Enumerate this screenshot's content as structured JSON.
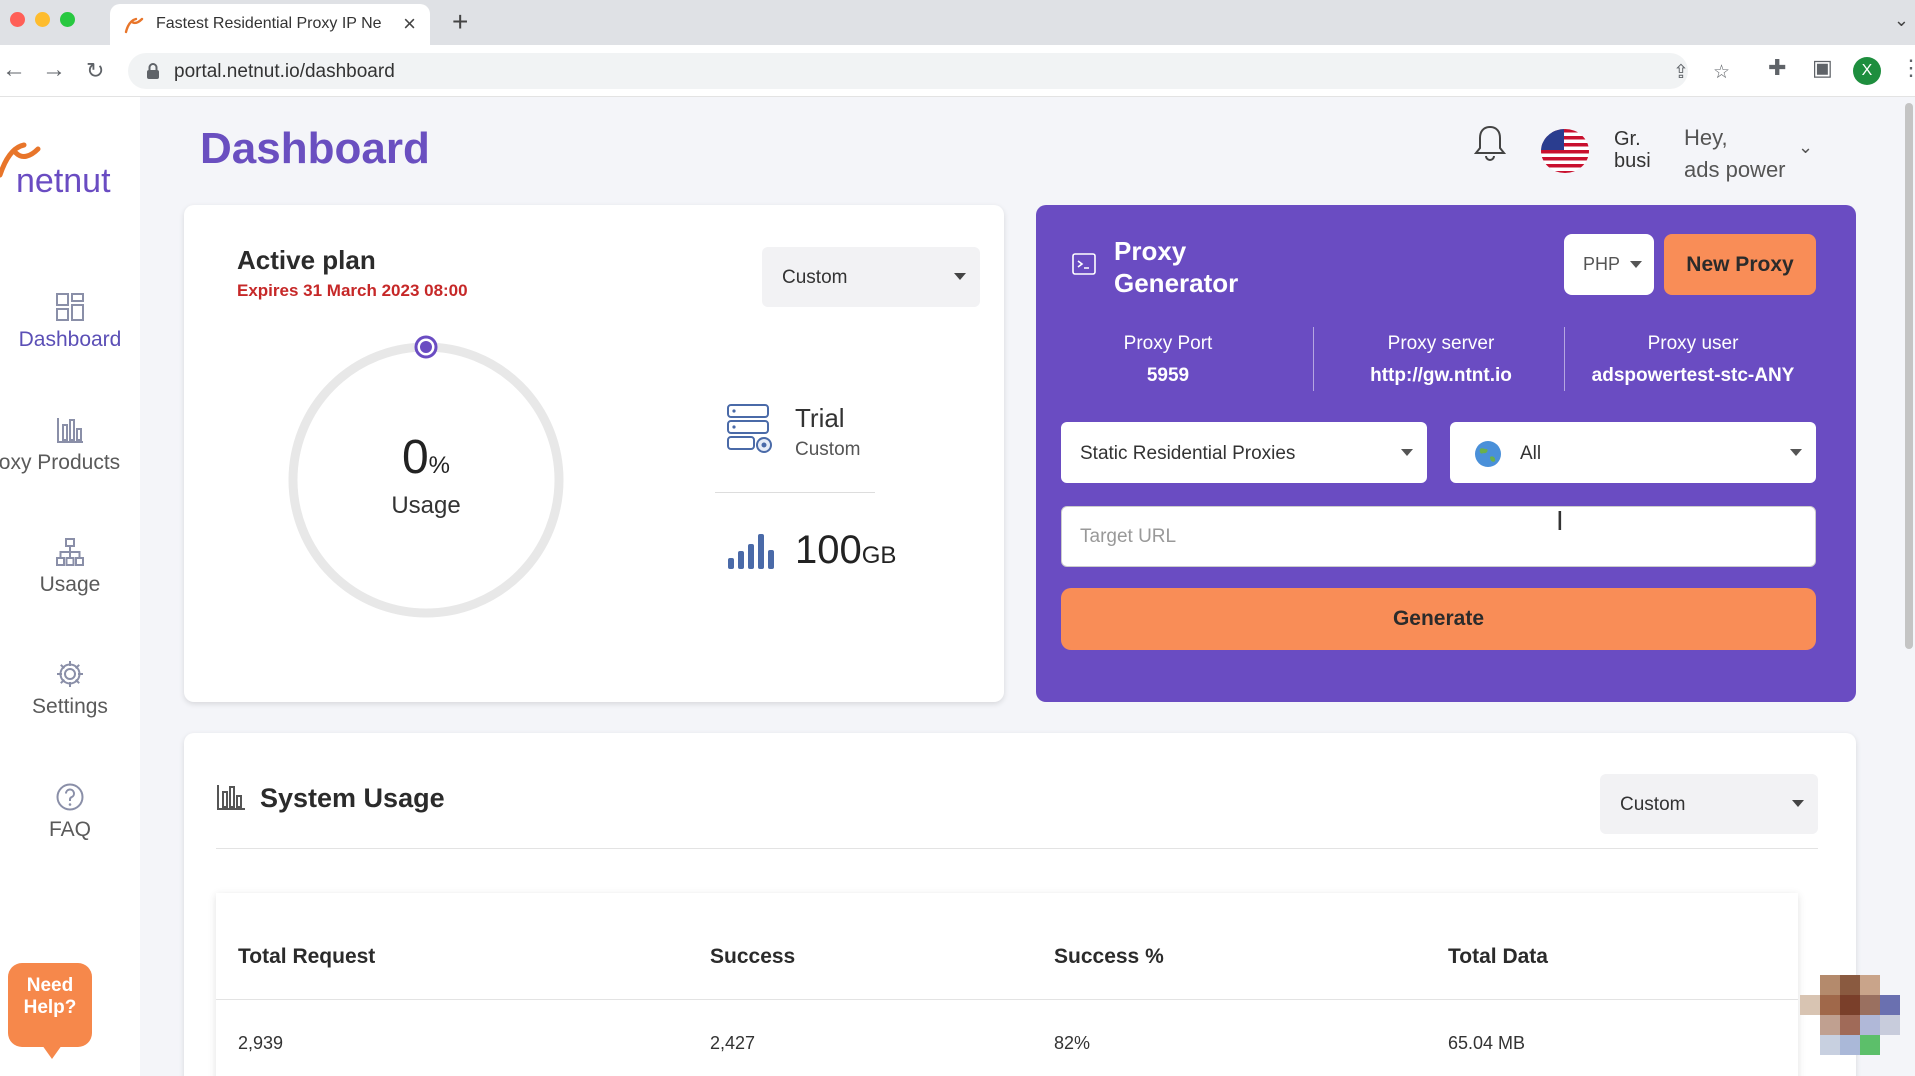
{
  "browser": {
    "tab_title": "Fastest Residential Proxy IP Ne",
    "new_tab": "+",
    "close": "×",
    "url": "portal.netnut.io/dashboard",
    "profile_initial": "X"
  },
  "sidebar": {
    "items": [
      {
        "label": "Dashboard",
        "icon": "dashboard-grid-icon",
        "active": true
      },
      {
        "label": "roxy Products",
        "icon": "bar-chart-icon"
      },
      {
        "label": "Usage",
        "icon": "hierarchy-icon"
      },
      {
        "label": "Settings",
        "icon": "gear-icon"
      },
      {
        "label": "FAQ",
        "icon": "help-circle-icon"
      }
    ],
    "need_help": "Need Help?"
  },
  "header": {
    "title": "Dashboard",
    "user_img_alt": "Gr. busi",
    "greeting": "Hey,",
    "user_name": "ads power"
  },
  "plan": {
    "title": "Active plan",
    "expires": "Expires 31 March 2023 08:00",
    "period": "Custom",
    "usage_value": "0",
    "usage_unit": "%",
    "usage_label": "Usage",
    "usage_fraction": 0.0,
    "plan_name": "Trial",
    "plan_sub": "Custom",
    "data_amount": "100",
    "data_unit": "GB"
  },
  "generator": {
    "title_line1": "Proxy",
    "title_line2": "Generator",
    "language": "PHP",
    "new_proxy": "New Proxy",
    "port_label": "Proxy Port",
    "port_value": "5959",
    "server_label": "Proxy server",
    "server_value": "http://gw.ntnt.io",
    "user_label": "Proxy user",
    "user_value": "adspowertest-stc-ANY",
    "product": "Static Residential Proxies",
    "country": "All",
    "target_placeholder": "Target URL",
    "generate": "Generate"
  },
  "system_usage": {
    "title": "System Usage",
    "period": "Custom",
    "columns": [
      "Total Request",
      "Success",
      "Success %",
      "Total Data"
    ],
    "rows": [
      [
        "2,939",
        "2,427",
        "82%",
        "65.04 MB"
      ]
    ]
  },
  "colors": {
    "brand_purple": "#6a4cc2",
    "accent_orange": "#f98d57",
    "alert_red": "#c62828"
  }
}
